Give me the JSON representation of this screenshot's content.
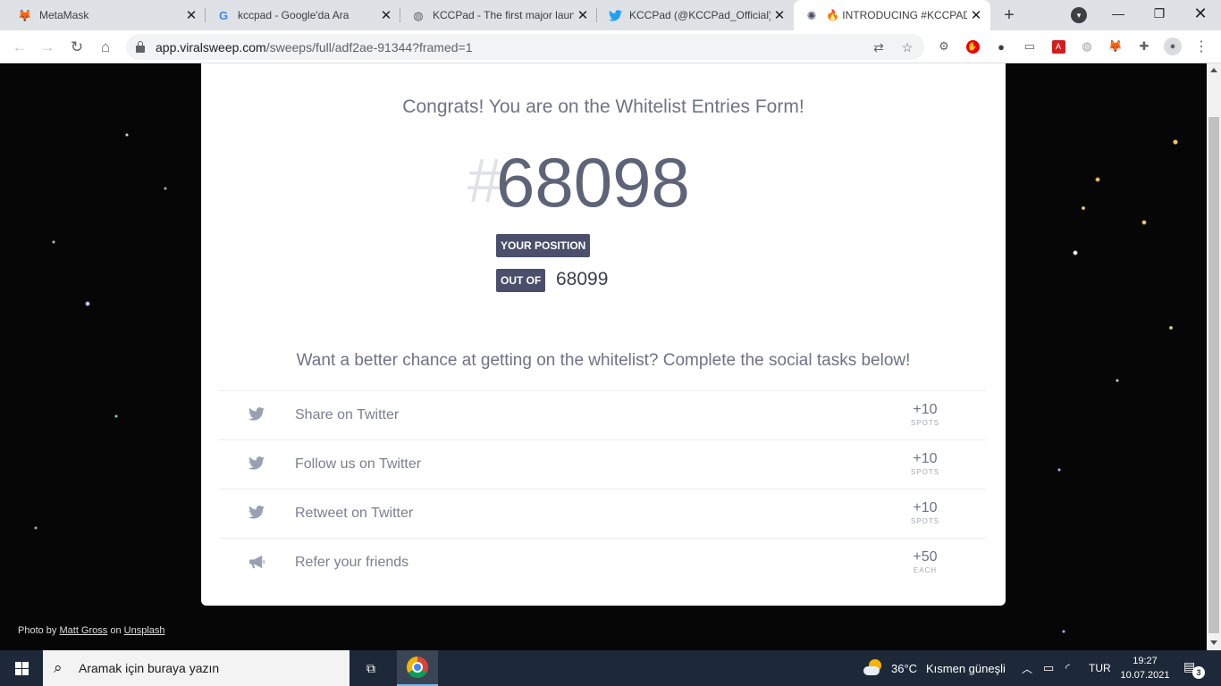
{
  "browser": {
    "tabs": [
      {
        "label": "MetaMask",
        "icon": "metamask-fox-icon",
        "active": false
      },
      {
        "label": "kccpad - Google'da Ara",
        "icon": "google-icon",
        "active": false
      },
      {
        "label": "KCCPad - The first major laun",
        "icon": "globe-icon",
        "active": false
      },
      {
        "label": "KCCPad (@KCCPad_Official) /",
        "icon": "twitter-icon",
        "active": false
      },
      {
        "label": "🔥 INTRODUCING #KCCPAD",
        "icon": "viralsweep-icon",
        "active": true
      }
    ],
    "url_host": "app.viralsweep.com",
    "url_path": "/sweeps/full/adf2ae-91344?framed=1"
  },
  "page": {
    "congrats": "Congrats! You are on the Whitelist Entries Form!",
    "hash": "#",
    "position": "68098",
    "your_position_label": "YOUR POSITION",
    "out_of_label": "OUT OF",
    "total": "68099",
    "want_text": "Want a better chance at getting on the whitelist? Complete the social tasks below!",
    "tasks": [
      {
        "label": "Share on Twitter",
        "points": "+10",
        "unit": "SPOTS",
        "icon": "twitter-icon"
      },
      {
        "label": "Follow us on Twitter",
        "points": "+10",
        "unit": "SPOTS",
        "icon": "twitter-icon"
      },
      {
        "label": "Retweet on Twitter",
        "points": "+10",
        "unit": "SPOTS",
        "icon": "twitter-icon"
      },
      {
        "label": "Refer your friends",
        "points": "+50",
        "unit": "EACH",
        "icon": "megaphone-icon"
      }
    ],
    "credit": {
      "prefix": "Photo by",
      "author": "Matt Gross",
      "middle": "on",
      "site": "Unsplash"
    }
  },
  "taskbar": {
    "search_placeholder": "Aramak için buraya yazın",
    "weather_temp": "36°C",
    "weather_text": "Kısmen güneşli",
    "language": "TUR",
    "time": "19:27",
    "date": "10.07.2021",
    "notification_count": "3"
  },
  "colors": {
    "accent_badge": "#4b4f6b",
    "position_text": "#5e6478",
    "twitter_icon": "#9aa0b0"
  }
}
